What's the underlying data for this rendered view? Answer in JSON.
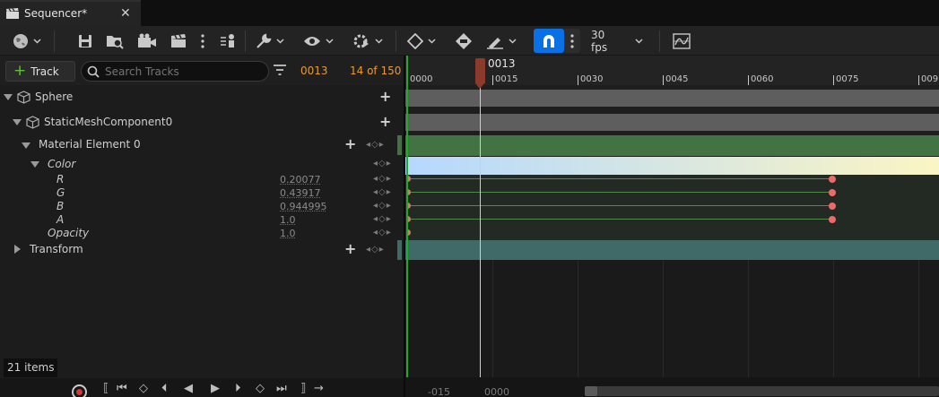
{
  "tab": {
    "title": "Sequencer*",
    "close": "✕"
  },
  "toolbar": {
    "fps": "30 fps",
    "icons": [
      "world-icon",
      "save-icon",
      "find-asset-icon",
      "render-movie-icon",
      "clapboard-icon",
      "more-icon",
      "actor-to-sequencer-icon",
      "wrench-icon",
      "eye-icon",
      "playback-gear-icon",
      "key-diamond-icon",
      "auto-key-icon",
      "brush-icon",
      "snap-magnet-icon",
      "curve-editor-icon"
    ]
  },
  "tracks_toolbar": {
    "add_track_label": "Track",
    "search_placeholder": "Search Tracks",
    "current_frame": "0013",
    "frame_count": "14 of 150"
  },
  "outliner": {
    "rows": [
      {
        "label": "Sphere"
      },
      {
        "label": "StaticMeshComponent0"
      },
      {
        "label": "Material Element 0"
      },
      {
        "label": "Color"
      },
      {
        "label": "R",
        "value": "0.20077"
      },
      {
        "label": "G",
        "value": "0.43917"
      },
      {
        "label": "B",
        "value": "0.944995"
      },
      {
        "label": "A",
        "value": "1.0"
      },
      {
        "label": "Opacity",
        "value": "1.0"
      },
      {
        "label": "Transform"
      }
    ],
    "item_count": "21 items"
  },
  "timeline": {
    "playhead_label": "0013",
    "ruler_labels": [
      "0000",
      "0015",
      "0030",
      "0045",
      "0060",
      "0075",
      "009"
    ],
    "view_start": "-015",
    "view_origin": "0000",
    "key_frames": [
      0,
      75
    ]
  },
  "colors": {
    "accent": "#0a70e6",
    "frame_text": "#e89a2c",
    "material_track": "#437343",
    "transform_track": "#3f6a68",
    "gradient_start": "#b5d8ff",
    "gradient_end": "#fbf5c4",
    "key": "#ee6a6a"
  }
}
